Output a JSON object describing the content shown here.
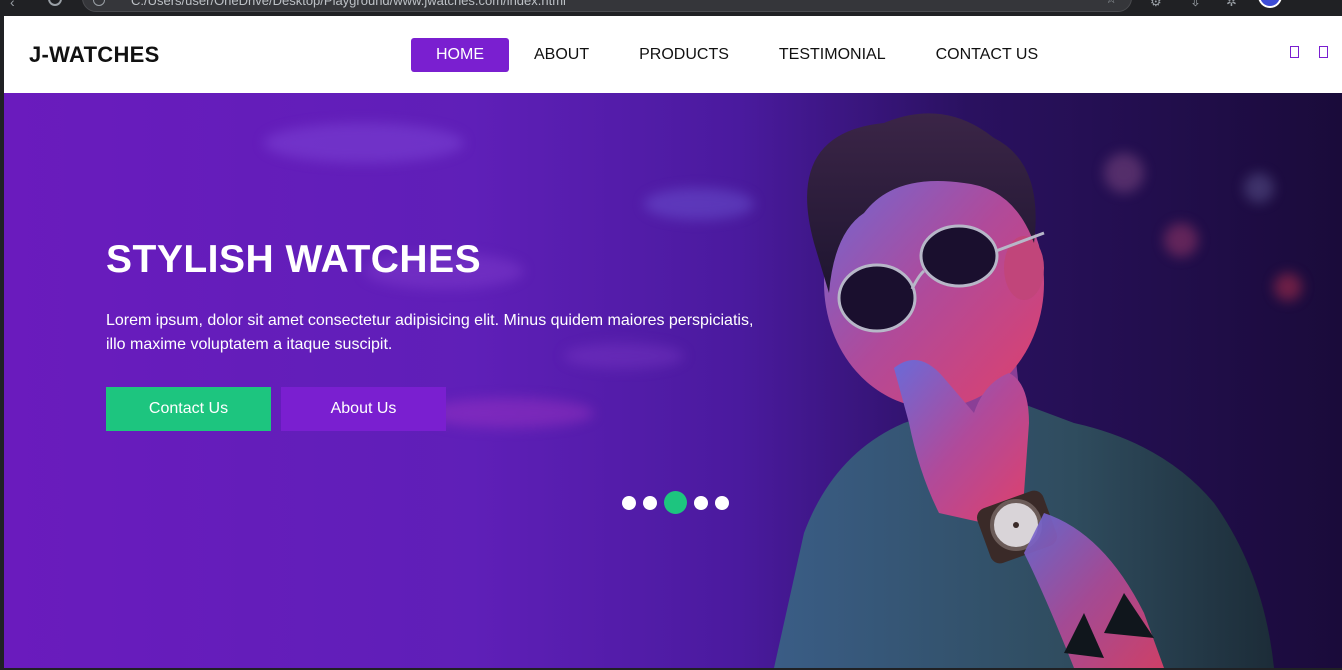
{
  "browser": {
    "address_text": "C:/Users/user/OneDrive/Desktop/Playground/www.jwatches.com/index.html"
  },
  "header": {
    "logo": "J-WATCHES",
    "nav": [
      {
        "label": "HOME",
        "active": true
      },
      {
        "label": "ABOUT",
        "active": false
      },
      {
        "label": "PRODUCTS",
        "active": false
      },
      {
        "label": "TESTIMONIAL",
        "active": false
      },
      {
        "label": "CONTACT US",
        "active": false
      }
    ],
    "icons": [
      "search-icon",
      "cart-icon"
    ]
  },
  "hero": {
    "title": "STYLISH WATCHES",
    "description": "Lorem ipsum, dolor sit amet consectetur adipisicing elit. Minus quidem maiores perspiciatis, illo maxime voluptatem a itaque suscipit.",
    "buttons": {
      "contact": "Contact Us",
      "about": "About Us"
    },
    "slider": {
      "count": 5,
      "active_index": 2
    }
  },
  "colors": {
    "accent_purple": "#7a1fd0",
    "accent_green": "#1dc57f",
    "text_dark": "#111111"
  }
}
